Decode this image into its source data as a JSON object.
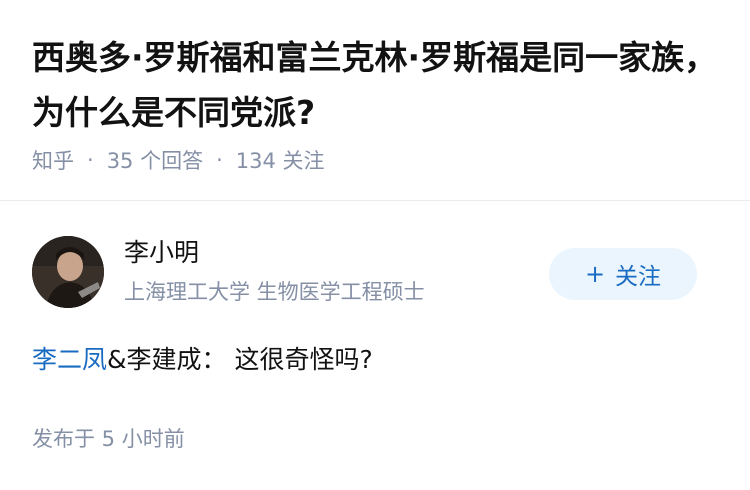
{
  "question": {
    "title": "西奥多·罗斯福和富兰克林·罗斯福是同一家族，为什么是不同党派?",
    "source": "知乎",
    "separator": "·",
    "answers_count": "35 个回答",
    "followers_count": "134 关注"
  },
  "author": {
    "name": "李小明",
    "bio": "上海理工大学 生物医学工程硕士",
    "follow_label": "关注",
    "follow_plus": "+"
  },
  "answer": {
    "link_text": "李二凤",
    "text": "&李建成： 这很奇怪吗?",
    "link_color": "#1a6bc2"
  },
  "footer": {
    "published": "发布于 5 小时前"
  }
}
